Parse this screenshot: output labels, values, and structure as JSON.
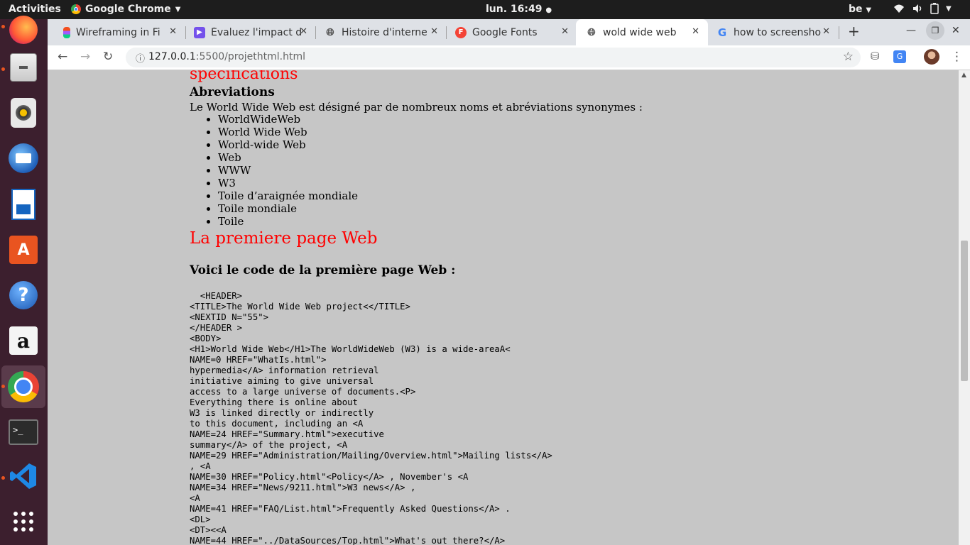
{
  "topbar": {
    "activities": "Activities",
    "app_name": "Google Chrome",
    "clock": "lun. 16:49",
    "keyboard_layout": "be"
  },
  "tabs": [
    {
      "title": "Wireframing in Fi",
      "favicon": "figma-icon",
      "active": false
    },
    {
      "title": "Évaluez l'impact d",
      "favicon": "openclassrooms-icon",
      "active": false
    },
    {
      "title": "Histoire d'interne",
      "favicon": "globe-icon",
      "active": false
    },
    {
      "title": "Google Fonts",
      "favicon": "google-fonts-icon",
      "active": false
    },
    {
      "title": "wold wide web",
      "favicon": "globe-icon",
      "active": true
    },
    {
      "title": "how to screensho",
      "favicon": "google-icon",
      "active": false
    }
  ],
  "toolbar": {
    "url_host": "127.0.0.1",
    "url_rest": ":5500/projethtml.html"
  },
  "page": {
    "heading_specs": "spécifications",
    "heading_abbrev": "Abreviations",
    "abbrev_intro": "Le World Wide Web est désigné par de nombreux noms et abréviations synonymes :",
    "abbrev_list": [
      "WorldWideWeb",
      "World Wide Web",
      "World-wide Web",
      "Web",
      "WWW",
      "W3",
      "Toile d’araignée mondiale",
      "Toile mondiale",
      "Toile"
    ],
    "heading_first_page": "La premiere page Web",
    "code_heading": "Voici le code de la première page Web :",
    "code_lines": [
      "  <HEADER>",
      "<TITLE>The World Wide Web project<</TITLE>",
      "<NEXTID N=\"55\">",
      "</HEADER >",
      "<BODY>",
      "<H1>World Wide Web</H1>The WorldWideWeb (W3) is a wide-areaA<",
      "NAME=0 HREF=\"WhatIs.html\">",
      "hypermedia</A> information retrieval",
      "initiative aiming to give universal",
      "access to a large universe of documents.<P>",
      "Everything there is online about",
      "W3 is linked directly or indirectly",
      "to this document, including an <A",
      "NAME=24 HREF=\"Summary.html\">executive",
      "summary</A> of the project, <A",
      "NAME=29 HREF=\"Administration/Mailing/Overview.html\">Mailing lists</A>",
      ", <A",
      "NAME=30 HREF=\"Policy.html\"<Policy</A> , November's <A",
      "NAME=34 HREF=\"News/9211.html\">W3 news</A> ,",
      "<A",
      "NAME=41 HREF=\"FAQ/List.html\">Frequently Asked Questions</A> .",
      "<DL>",
      "<DT><<A",
      "NAME=44 HREF=\"../DataSources/Top.html\">What's out there?</A>"
    ]
  },
  "colors": {
    "page_bg": "#c6c6c6",
    "heading_red": "#ff0000",
    "dock_bg": "#3c1f2e",
    "topbar_bg": "#1d1d1d"
  }
}
